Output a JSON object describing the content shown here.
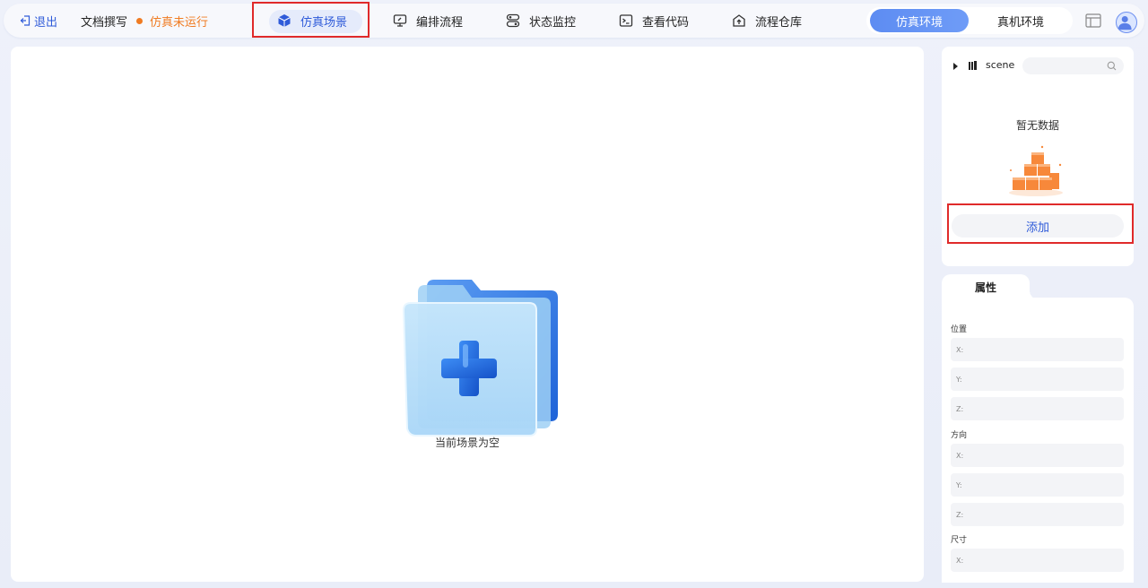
{
  "header": {
    "exit_label": "退出",
    "doc_label": "文档撰写",
    "status_label": "仿真未运行",
    "tabs": [
      {
        "label": "仿真场景",
        "icon": "cube-icon",
        "active": true
      },
      {
        "label": "编排流程",
        "icon": "monitor-edit-icon",
        "active": false
      },
      {
        "label": "状态监控",
        "icon": "toggle-status-icon",
        "active": false
      },
      {
        "label": "查看代码",
        "icon": "terminal-icon",
        "active": false
      },
      {
        "label": "流程仓库",
        "icon": "repo-upload-icon",
        "active": false
      }
    ],
    "env_sim_label": "仿真环境",
    "env_real_label": "真机环境"
  },
  "canvas": {
    "empty_text": "当前场景为空"
  },
  "scene_panel": {
    "tree_label": "scene",
    "search_placeholder": "",
    "nodata_text": "暂无数据",
    "add_label": "添加"
  },
  "properties": {
    "tab_label": "属性",
    "position_label": "位置",
    "direction_label": "方向",
    "size_label": "尺寸",
    "axis_x": "X:",
    "axis_y": "Y:",
    "axis_z": "Z:"
  },
  "colors": {
    "accent": "#2f5bd9",
    "status": "#f07b22",
    "highlight": "#e02a2a"
  }
}
